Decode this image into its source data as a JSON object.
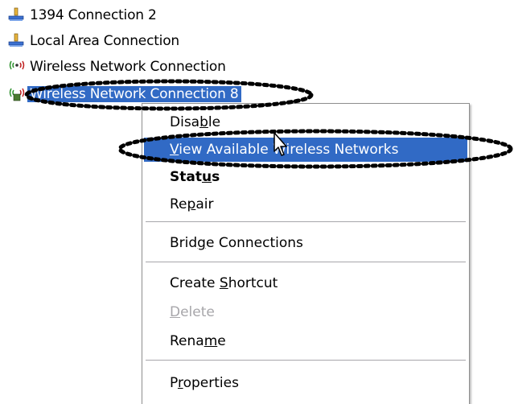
{
  "connections": [
    {
      "label": "1394 Connection 2",
      "icon": "wired-network-icon"
    },
    {
      "label": "Local Area Connection",
      "icon": "wired-network-icon"
    },
    {
      "label": "Wireless Network Connection",
      "icon": "wireless-network-icon"
    },
    {
      "label": "Wireless Network Connection 8",
      "icon": "wireless-network-icon",
      "selected": true
    }
  ],
  "context_menu": {
    "items": [
      {
        "label": "Disable",
        "mnemonic": "b"
      },
      {
        "label": "View Available Wireless Networks",
        "mnemonic": "V",
        "highlighted": true
      },
      {
        "label": "Status",
        "mnemonic": "u",
        "bold": true
      },
      {
        "label": "Repair",
        "mnemonic": "p"
      },
      {
        "label": "Bridge Connections",
        "mnemonic": "g"
      },
      {
        "label": "Create Shortcut",
        "mnemonic": "S"
      },
      {
        "label": "Delete",
        "mnemonic": "D",
        "disabled": true
      },
      {
        "label": "Rename",
        "mnemonic": "m"
      },
      {
        "label": "Properties",
        "mnemonic": "r"
      }
    ]
  },
  "colors": {
    "selection": "#316ac5",
    "disabled_text": "#a7a6aa",
    "annotation": "#000000"
  }
}
